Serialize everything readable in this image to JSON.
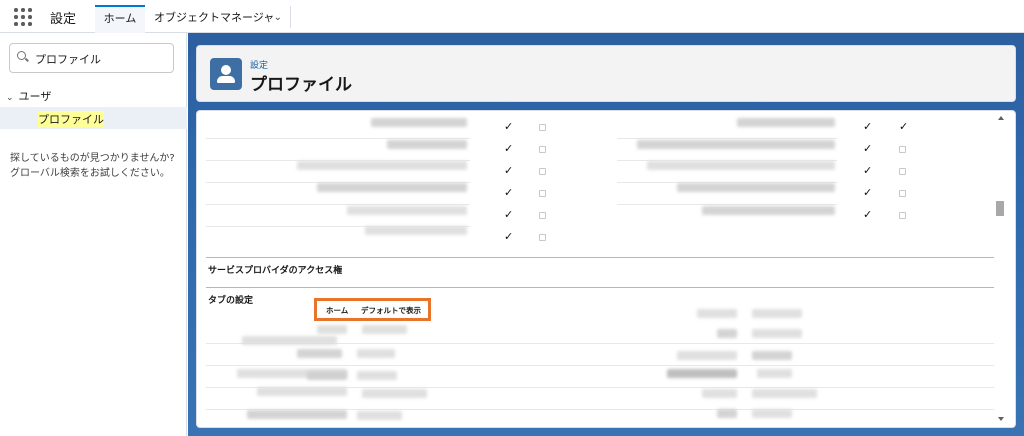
{
  "app": {
    "name": "設定"
  },
  "tabs": [
    {
      "label": "ホーム",
      "active": true
    },
    {
      "label": "オブジェクトマネージャ",
      "active": false
    }
  ],
  "sidebar": {
    "search": {
      "value": "プロファイル",
      "placeholder": ""
    },
    "tree": {
      "parent": "ユーザ",
      "child": "プロファイル"
    },
    "help_line1": "探しているものが見つかりませんか?",
    "help_line2": "グローバル検索をお試しください。"
  },
  "header": {
    "breadcrumb": "設定",
    "title": "プロファイル",
    "icon": "profile-icon"
  },
  "content": {
    "section_service_provider": "サービスプロバイダのアクセス権",
    "section_tabs": "タブの設定",
    "tab_columns": {
      "home": "ホーム",
      "default_display": "デフォルトで表示"
    },
    "check_glyph": "✓"
  },
  "colors": {
    "accent": "#0176d3",
    "header_icon": "#3e6fa4",
    "highlight_box": "#e8742a",
    "background": "#2f69ad"
  }
}
